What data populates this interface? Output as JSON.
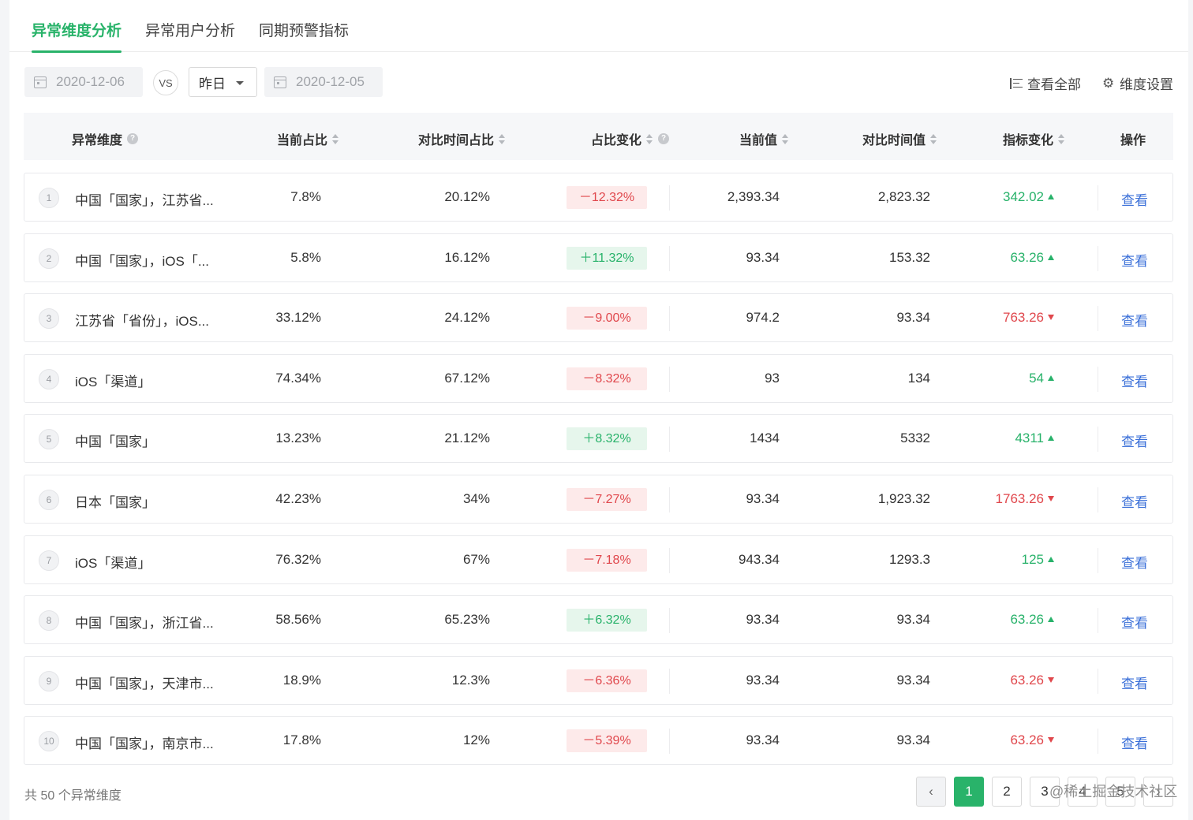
{
  "tabs": [
    {
      "label": "异常维度分析",
      "active": true
    },
    {
      "label": "异常用户分析",
      "active": false
    },
    {
      "label": "同期预警指标",
      "active": false
    }
  ],
  "filters": {
    "date_current": "2020-12-06",
    "vs_label": "VS",
    "compare_select": "昨日",
    "date_compare": "2020-12-05"
  },
  "toolbar": {
    "view_all": "查看全部",
    "dimension_settings": "维度设置"
  },
  "table": {
    "headers": {
      "dimension": "异常维度",
      "current_ratio": "当前占比",
      "compare_ratio": "对比时间占比",
      "ratio_change": "占比变化",
      "current_value": "当前值",
      "compare_value": "对比时间值",
      "metric_change": "指标变化",
      "action": "操作"
    },
    "rows": [
      {
        "index": "1",
        "dimension": "中国「国家」，江苏省...",
        "current_ratio": "7.8%",
        "compare_ratio": "20.12%",
        "ratio_change": "－12.32%",
        "ratio_dir": "down",
        "current_value": "2,393.34",
        "compare_value": "2,823.32",
        "metric_change": "342.02",
        "metric_dir": "up",
        "action": "查看"
      },
      {
        "index": "2",
        "dimension": "中国「国家」，iOS「...",
        "current_ratio": "5.8%",
        "compare_ratio": "16.12%",
        "ratio_change": "＋11.32%",
        "ratio_dir": "up",
        "current_value": "93.34",
        "compare_value": "153.32",
        "metric_change": "63.26",
        "metric_dir": "up",
        "action": "查看"
      },
      {
        "index": "3",
        "dimension": "江苏省「省份」，iOS...",
        "current_ratio": "33.12%",
        "compare_ratio": "24.12%",
        "ratio_change": "－9.00%",
        "ratio_dir": "down",
        "current_value": "974.2",
        "compare_value": "93.34",
        "metric_change": "763.26",
        "metric_dir": "down",
        "action": "查看"
      },
      {
        "index": "4",
        "dimension": "iOS「渠道」",
        "current_ratio": "74.34%",
        "compare_ratio": "67.12%",
        "ratio_change": "－8.32%",
        "ratio_dir": "down",
        "current_value": "93",
        "compare_value": "134",
        "metric_change": "54",
        "metric_dir": "up",
        "action": "查看"
      },
      {
        "index": "5",
        "dimension": "中国「国家」",
        "current_ratio": "13.23%",
        "compare_ratio": "21.12%",
        "ratio_change": "＋8.32%",
        "ratio_dir": "up",
        "current_value": "1434",
        "compare_value": "5332",
        "metric_change": "4311",
        "metric_dir": "up",
        "action": "查看"
      },
      {
        "index": "6",
        "dimension": "日本「国家」",
        "current_ratio": "42.23%",
        "compare_ratio": "34%",
        "ratio_change": "－7.27%",
        "ratio_dir": "down",
        "current_value": "93.34",
        "compare_value": "1,923.32",
        "metric_change": "1763.26",
        "metric_dir": "down",
        "action": "查看"
      },
      {
        "index": "7",
        "dimension": "iOS「渠道」",
        "current_ratio": "76.32%",
        "compare_ratio": "67%",
        "ratio_change": "－7.18%",
        "ratio_dir": "down",
        "current_value": "943.34",
        "compare_value": "1293.3",
        "metric_change": "125",
        "metric_dir": "up",
        "action": "查看"
      },
      {
        "index": "8",
        "dimension": "中国「国家」，浙江省...",
        "current_ratio": "58.56%",
        "compare_ratio": "65.23%",
        "ratio_change": "＋6.32%",
        "ratio_dir": "up",
        "current_value": "93.34",
        "compare_value": "93.34",
        "metric_change": "63.26",
        "metric_dir": "up",
        "action": "查看"
      },
      {
        "index": "9",
        "dimension": "中国「国家」，天津市...",
        "current_ratio": "18.9%",
        "compare_ratio": "12.3%",
        "ratio_change": "－6.36%",
        "ratio_dir": "down",
        "current_value": "93.34",
        "compare_value": "93.34",
        "metric_change": "63.26",
        "metric_dir": "down",
        "action": "查看"
      },
      {
        "index": "10",
        "dimension": "中国「国家」，南京市...",
        "current_ratio": "17.8%",
        "compare_ratio": "12%",
        "ratio_change": "－5.39%",
        "ratio_dir": "down",
        "current_value": "93.34",
        "compare_value": "93.34",
        "metric_change": "63.26",
        "metric_dir": "down",
        "action": "查看"
      }
    ]
  },
  "footer": {
    "total_text": "共 50 个异常维度",
    "pages": [
      "1",
      "2",
      "3",
      "4",
      "5"
    ],
    "current_page": "1",
    "prev_icon": "chevron-left-icon",
    "next_icon": "chevron-right-icon"
  },
  "watermark": "@稀土掘金技术社区",
  "colors": {
    "accent": "#29b36a",
    "up": "#28b26a",
    "down": "#e0474c",
    "link": "#3a6fd8"
  }
}
